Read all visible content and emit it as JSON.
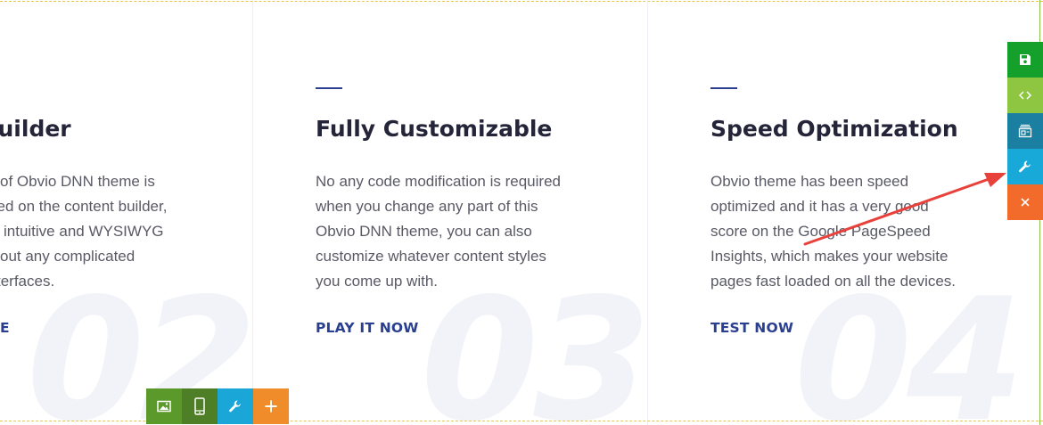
{
  "cards": [
    {
      "number": "02",
      "title": "nt Builder",
      "lines": [
        "of Obvio DNN theme is",
        "sed on the content builder,",
        "intuitive and WYSIWYG",
        "out any complicated",
        "terfaces."
      ],
      "link": "E"
    },
    {
      "number": "03",
      "title": "Fully Customizable",
      "lines": [
        "No any code modification is required",
        "when you change any part of this",
        "Obvio DNN theme, you can also",
        "customize whatever content styles",
        "you come up with."
      ],
      "link": "PLAY IT NOW"
    },
    {
      "number": "04",
      "title": "Speed Optimization",
      "lines": [
        "Obvio theme has been speed",
        "optimized and it has a very good",
        "score on the Google PageSpeed",
        "Insights, which makes your website",
        "pages fast loaded on all the devices."
      ],
      "link": "TEST NOW"
    }
  ],
  "bottom_toolbar": [
    {
      "icon": "image-icon",
      "color": "#5b9a2a"
    },
    {
      "icon": "mobile-icon",
      "color": "#4e7f26"
    },
    {
      "icon": "wrench-icon",
      "color": "#1aa7d8"
    },
    {
      "icon": "plus-icon",
      "label": "+",
      "color": "#f08c2a"
    }
  ],
  "side_toolbar": [
    {
      "icon": "save-icon",
      "color": "#15a02c"
    },
    {
      "icon": "code-icon",
      "label": "<>",
      "color": "#8fc641"
    },
    {
      "icon": "layout-icon",
      "color": "#1a7fa0"
    },
    {
      "icon": "wrench-icon",
      "color": "#18a9d9"
    },
    {
      "icon": "close-icon",
      "label": "✕",
      "color": "#f26b2a"
    }
  ],
  "colors": {
    "accent": "#2a3f8f",
    "arrow": "#e8403a"
  }
}
